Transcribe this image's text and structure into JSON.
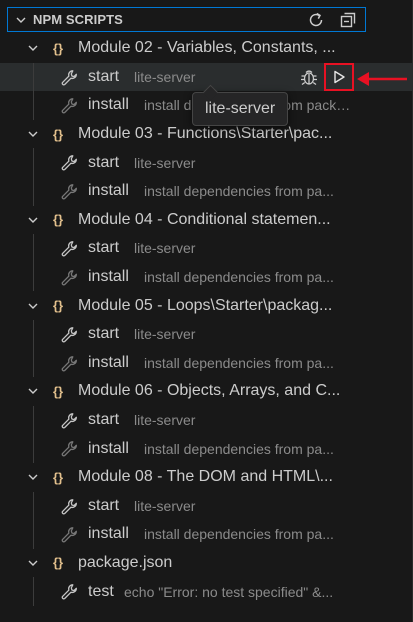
{
  "header": {
    "title": "NPM SCRIPTS",
    "actions": [
      {
        "icon": "refresh-icon"
      },
      {
        "icon": "collapse-all-icon"
      }
    ]
  },
  "tree": [
    {
      "kind": "folder",
      "label": "Module 02 - Variables, Constants, ...",
      "children": [
        {
          "name": "start",
          "desc": "lite-server",
          "selected": true
        },
        {
          "name": "install",
          "desc": "install dependencies from package"
        }
      ]
    },
    {
      "kind": "folder",
      "label": "Module 03 - Functions\\Starter\\pac...",
      "children": [
        {
          "name": "start",
          "desc": "lite-server"
        },
        {
          "name": "install",
          "desc": "install dependencies from pa..."
        }
      ]
    },
    {
      "kind": "folder",
      "label": "Module 04 - Conditional statemen...",
      "children": [
        {
          "name": "start",
          "desc": "lite-server"
        },
        {
          "name": "install",
          "desc": "install dependencies from pa..."
        }
      ]
    },
    {
      "kind": "folder",
      "label": "Module 05 - Loops\\Starter\\packag...",
      "children": [
        {
          "name": "start",
          "desc": "lite-server"
        },
        {
          "name": "install",
          "desc": "install dependencies from pa..."
        }
      ]
    },
    {
      "kind": "folder",
      "label": "Module 06 - Objects, Arrays, and C...",
      "children": [
        {
          "name": "start",
          "desc": "lite-server"
        },
        {
          "name": "install",
          "desc": "install dependencies from pa..."
        }
      ]
    },
    {
      "kind": "folder",
      "label": "Module 08 - The DOM and HTML\\...",
      "children": [
        {
          "name": "start",
          "desc": "lite-server"
        },
        {
          "name": "install",
          "desc": "install dependencies from pa..."
        }
      ]
    },
    {
      "kind": "folder",
      "label": "package.json",
      "children": [
        {
          "name": "test",
          "desc": "echo \"Error: no test specified\" &..."
        }
      ]
    }
  ],
  "tooltip": {
    "text": "lite-server"
  },
  "colors": {
    "accent_border": "#0078d4",
    "highlight_box": "#e81123",
    "braces": "#e2c08d"
  }
}
